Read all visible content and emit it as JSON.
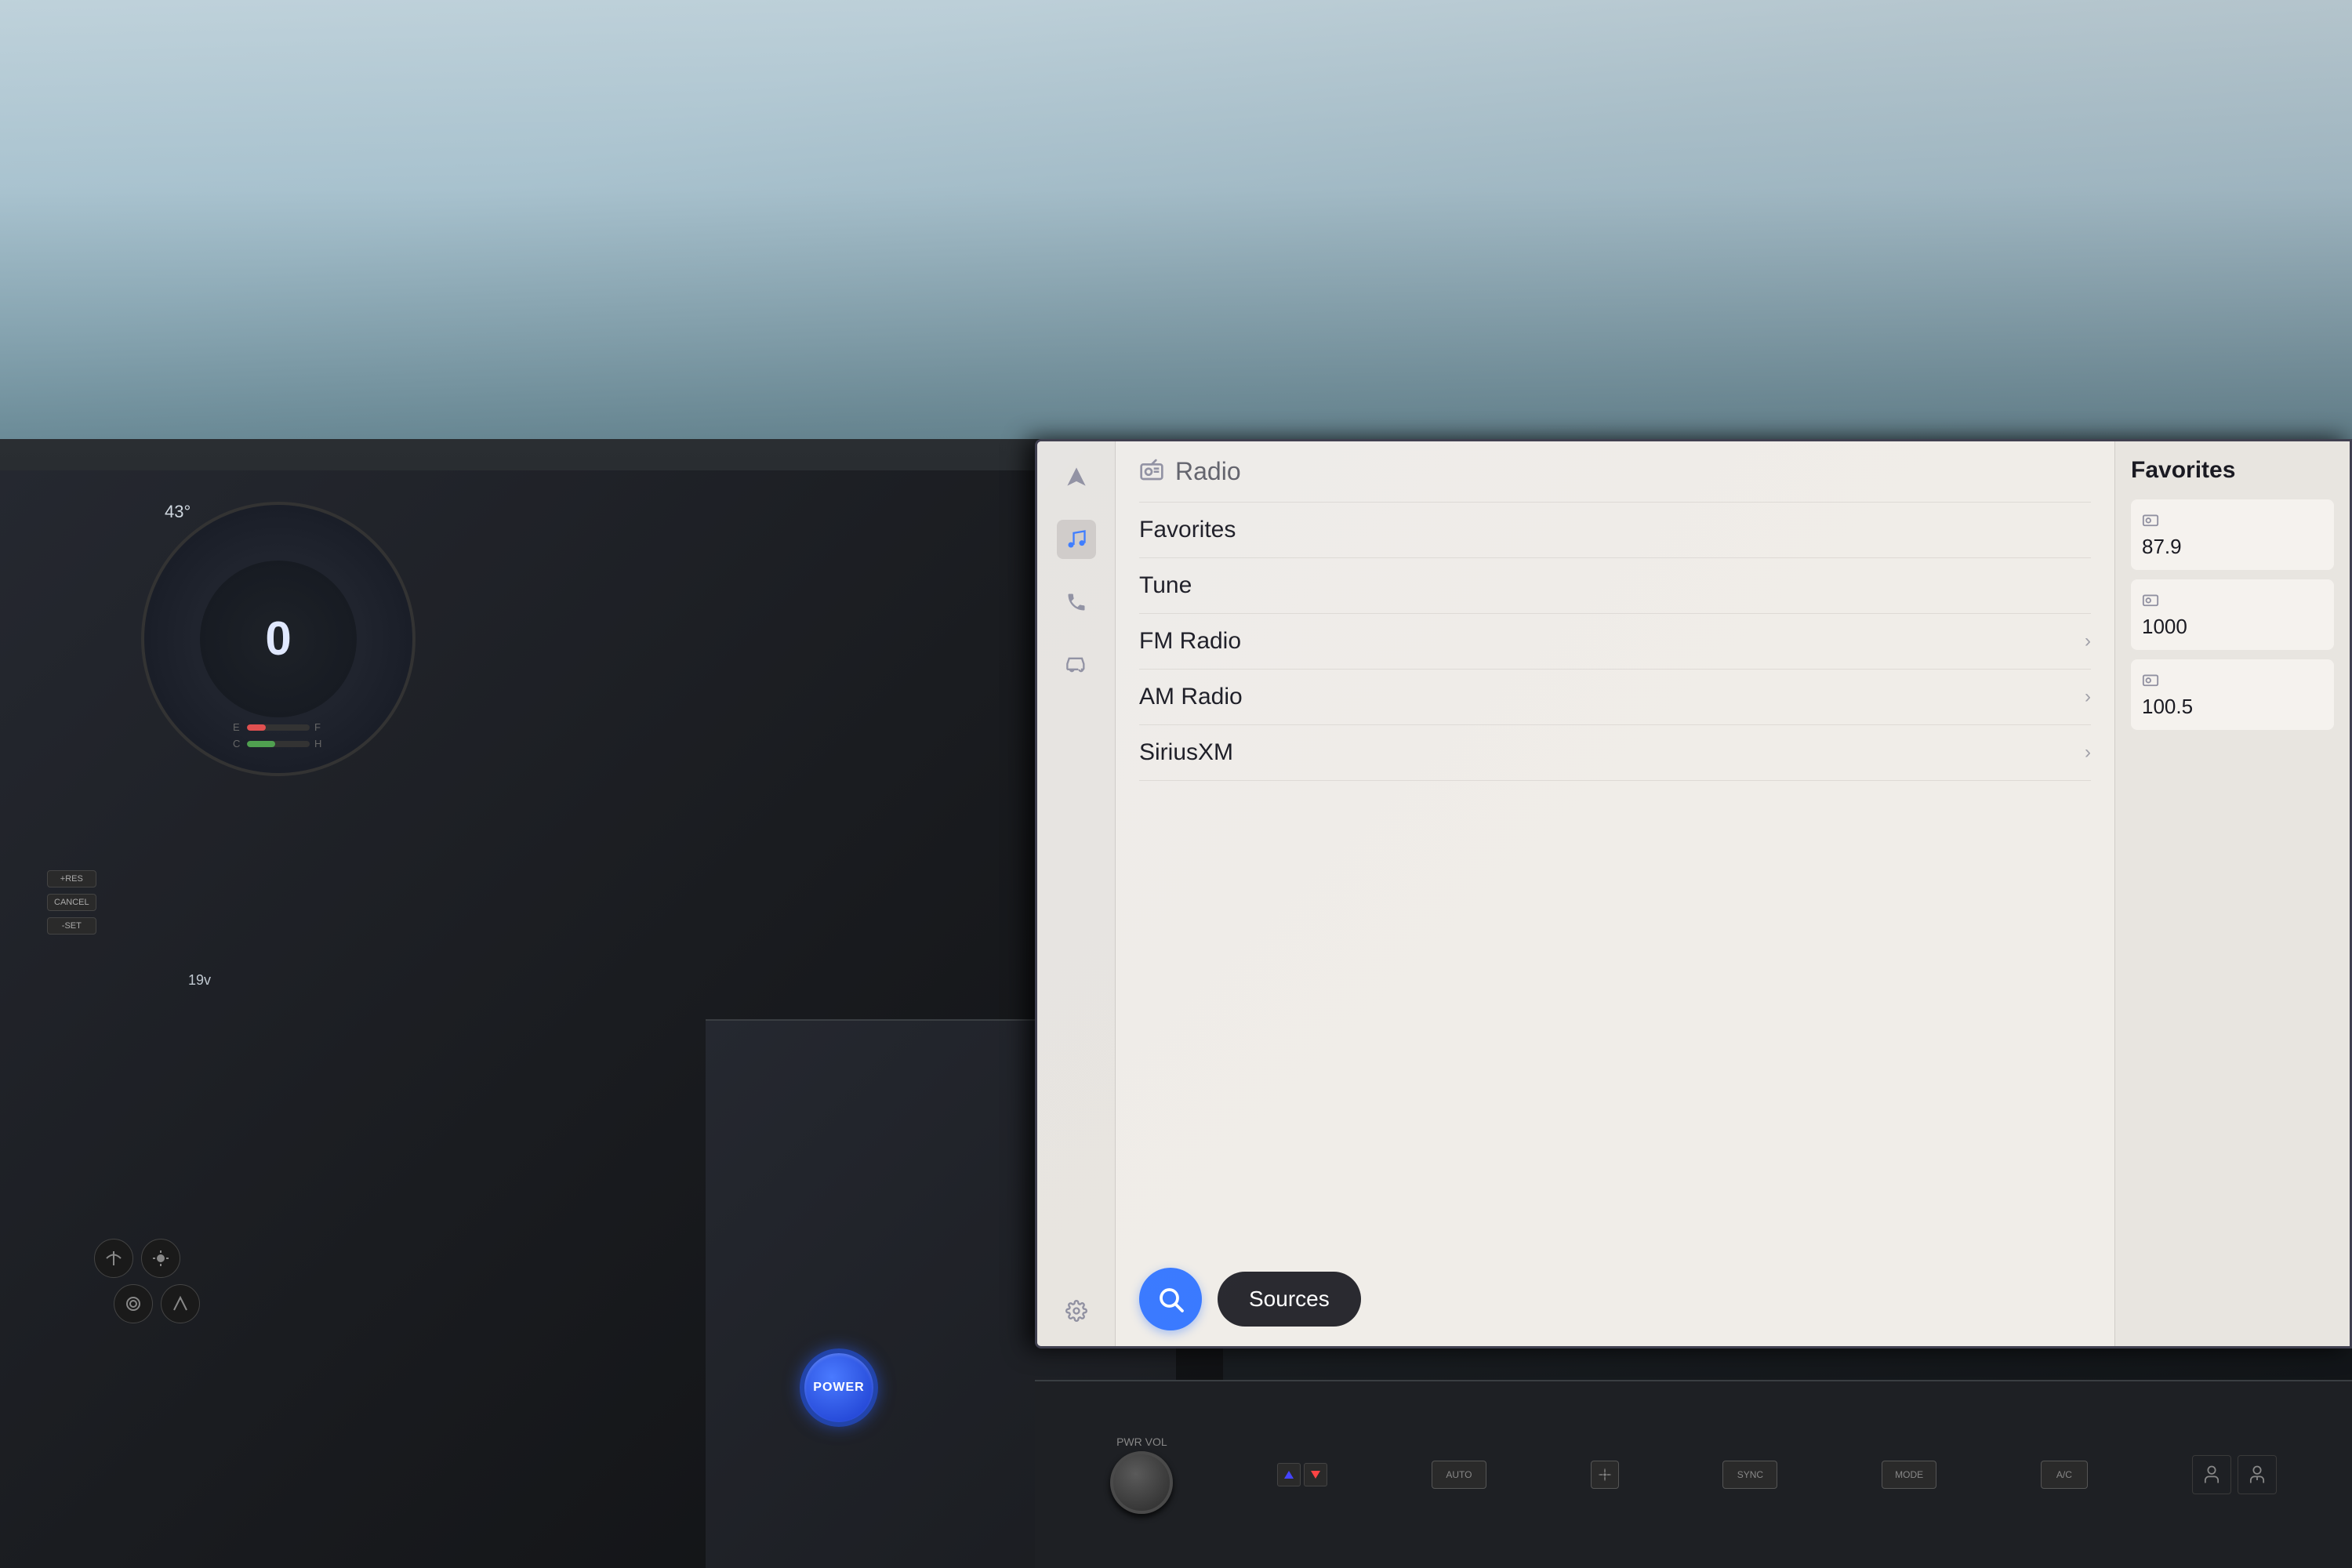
{
  "background": {
    "windshield_color": "#b0c8d4",
    "dashboard_color": "#1e2226"
  },
  "instrument_cluster": {
    "speed": "0",
    "temp_label": "43°",
    "voltage": "19v",
    "gauge_e_label": "E",
    "gauge_f_label": "F",
    "gauge_c_label": "C",
    "gauge_h_label": "H"
  },
  "infotainment": {
    "header": {
      "icon": "📻",
      "title": "Radio"
    },
    "menu_items": [
      {
        "label": "Favorites",
        "has_arrow": false
      },
      {
        "label": "Tune",
        "has_arrow": false
      },
      {
        "label": "FM Radio",
        "has_arrow": true
      },
      {
        "label": "AM Radio",
        "has_arrow": true
      },
      {
        "label": "SiriusXM",
        "has_arrow": true
      }
    ],
    "search_button_icon": "🔍",
    "sources_button_label": "Sources",
    "right_panel": {
      "title": "Favorites",
      "items": [
        {
          "icon": "📻",
          "value": "87.9"
        },
        {
          "icon": "📻",
          "value": "1000"
        },
        {
          "icon": "📻",
          "value": "100.5"
        }
      ]
    }
  },
  "hardware_controls": {
    "pwr_vol_label": "PWR VOL",
    "auto_label": "AUTO",
    "sync_label": "SYNC",
    "mode_label": "MODE",
    "ac_label": "A/C"
  },
  "steering_controls": {
    "res_label": "+RES",
    "set_label": "-SET",
    "cancel_label": "CANCEL"
  },
  "power_button": {
    "label": "POWER"
  },
  "nav_icons": {
    "navigation": "nav-icon",
    "music": "music-icon",
    "phone": "phone-icon",
    "car": "car-icon",
    "settings": "settings-icon"
  }
}
